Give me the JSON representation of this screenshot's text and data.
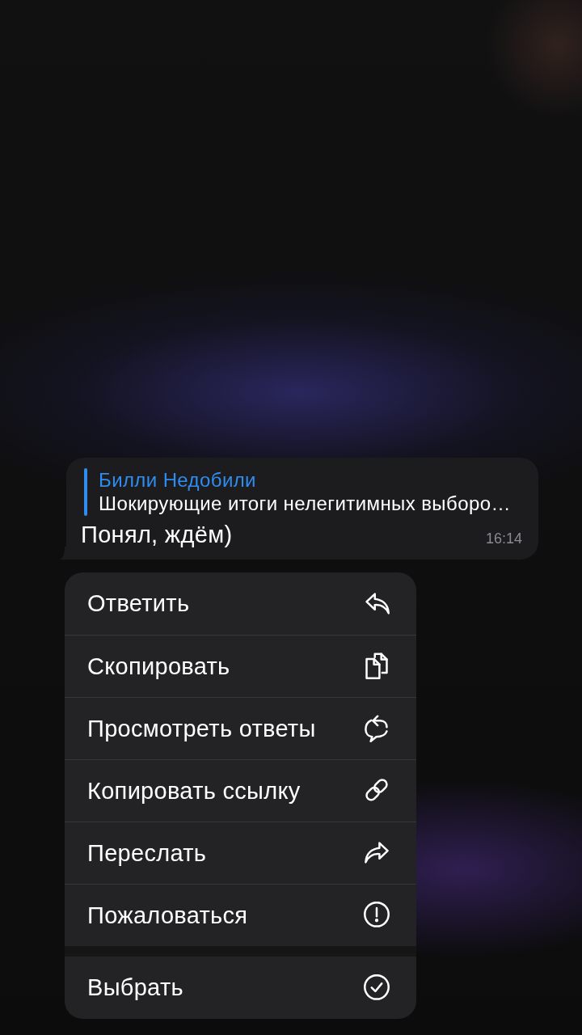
{
  "message": {
    "reply": {
      "author": "Билли Недобили",
      "text": "Шокирующие итоги нелегитимных выборо…"
    },
    "text": "Понял, ждём)",
    "time": "16:14"
  },
  "menu": {
    "groups": [
      {
        "items": [
          {
            "label": "Ответить",
            "kind": "reply"
          },
          {
            "label": "Скопировать",
            "kind": "copy"
          },
          {
            "label": "Просмотреть ответы",
            "kind": "replies"
          },
          {
            "label": "Копировать ссылку",
            "kind": "link"
          },
          {
            "label": "Переслать",
            "kind": "forward"
          },
          {
            "label": "Пожаловаться",
            "kind": "report"
          }
        ]
      },
      {
        "items": [
          {
            "label": "Выбрать",
            "kind": "select"
          }
        ]
      }
    ]
  }
}
